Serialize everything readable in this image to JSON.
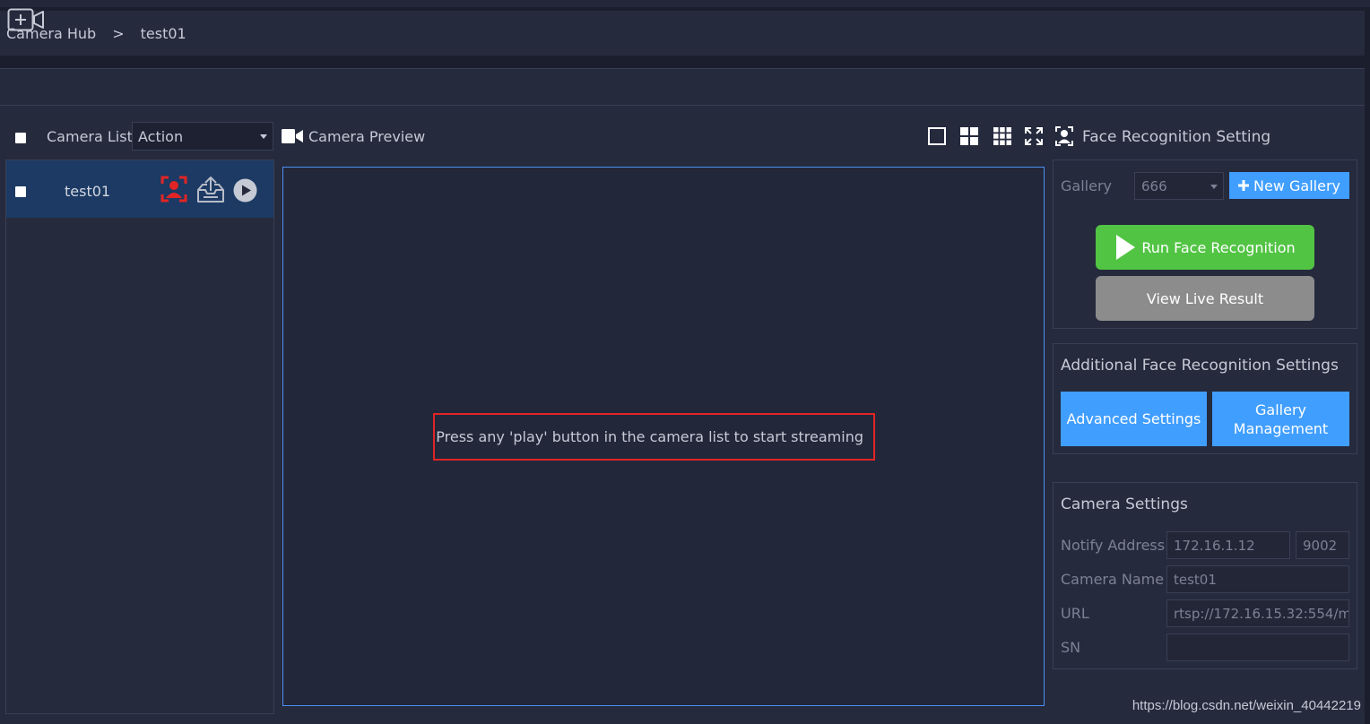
{
  "breadcrumb": {
    "root": "Camera Hub",
    "separator": ">",
    "current": "test01"
  },
  "camera_list": {
    "title": "Camera List",
    "action_select": "Action",
    "items": [
      {
        "name": "test01"
      }
    ]
  },
  "preview": {
    "title": "Camera Preview",
    "hint": "Press any 'play' button in the camera list to start streaming"
  },
  "face_recognition": {
    "title": "Face Recognition Setting",
    "gallery_label": "Gallery",
    "gallery_value": "666",
    "new_gallery": "New Gallery",
    "run_button": "Run Face Recognition",
    "view_live": "View Live Result"
  },
  "additional": {
    "title": "Additional Face Recognition Settings",
    "advanced": "Advanced Settings",
    "gallery_mgmt": "Gallery Management"
  },
  "camera_settings": {
    "title": "Camera Settings",
    "notify_label": "Notify Address",
    "notify_ip": "172.16.1.12",
    "notify_port": "9002",
    "name_label": "Camera Name",
    "name_value": "test01",
    "url_label": "URL",
    "url_value": "rtsp://172.16.15.32:554/m",
    "sn_label": "SN",
    "sn_value": ""
  },
  "watermark": "https://blog.csdn.net/weixin_40442219",
  "colors": {
    "background": "#252a3d",
    "selected_row": "#1c3a63",
    "accent_blue": "#409eff",
    "run_green": "#52c444",
    "hint_border": "#e02525"
  }
}
